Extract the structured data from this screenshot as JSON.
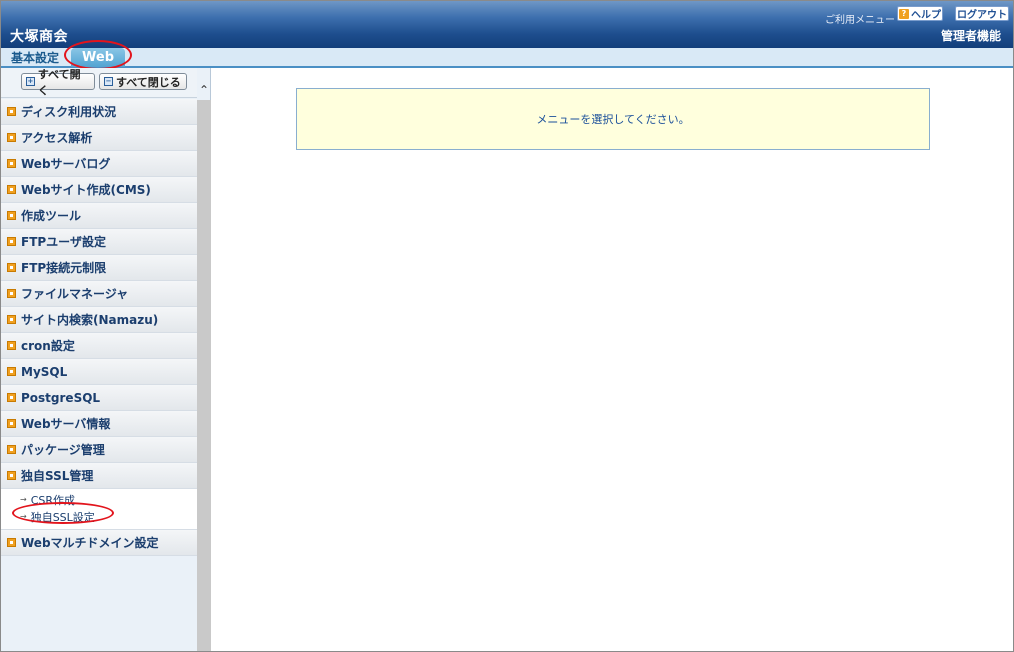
{
  "header": {
    "site_title": "大塚商会",
    "user_menu_label": "ご利用メニュー",
    "help_label": "ヘルプ",
    "help_icon": "?",
    "logout_label": "ログアウト",
    "admin_label": "管理者機能"
  },
  "tabs": {
    "basic": "基本設定",
    "web": "Web"
  },
  "sidebar": {
    "expand_all": "すべて開く",
    "collapse_all": "すべて閉じる",
    "items": [
      {
        "label": "ディスク利用状況"
      },
      {
        "label": "アクセス解析"
      },
      {
        "label": "Webサーバログ"
      },
      {
        "label": "Webサイト作成(CMS)"
      },
      {
        "label": "作成ツール"
      },
      {
        "label": "FTPユーザ設定"
      },
      {
        "label": "FTP接続元制限"
      },
      {
        "label": "ファイルマネージャ"
      },
      {
        "label": "サイト内検索(Namazu)"
      },
      {
        "label": "cron設定"
      },
      {
        "label": "MySQL"
      },
      {
        "label": "PostgreSQL"
      },
      {
        "label": "Webサーバ情報"
      },
      {
        "label": "パッケージ管理"
      },
      {
        "label": "独自SSL管理"
      },
      {
        "label": "Webマルチドメイン設定"
      }
    ],
    "ssl_sub": [
      {
        "label": "CSR作成"
      },
      {
        "label": "独自SSL設定"
      }
    ]
  },
  "main": {
    "notice": "メニューを選択してください。"
  },
  "colors": {
    "header_dark": "#123e7a",
    "accent_tab": "#52a4d2",
    "highlight_circle": "#e2141c",
    "notice_bg": "#ffffdd"
  }
}
